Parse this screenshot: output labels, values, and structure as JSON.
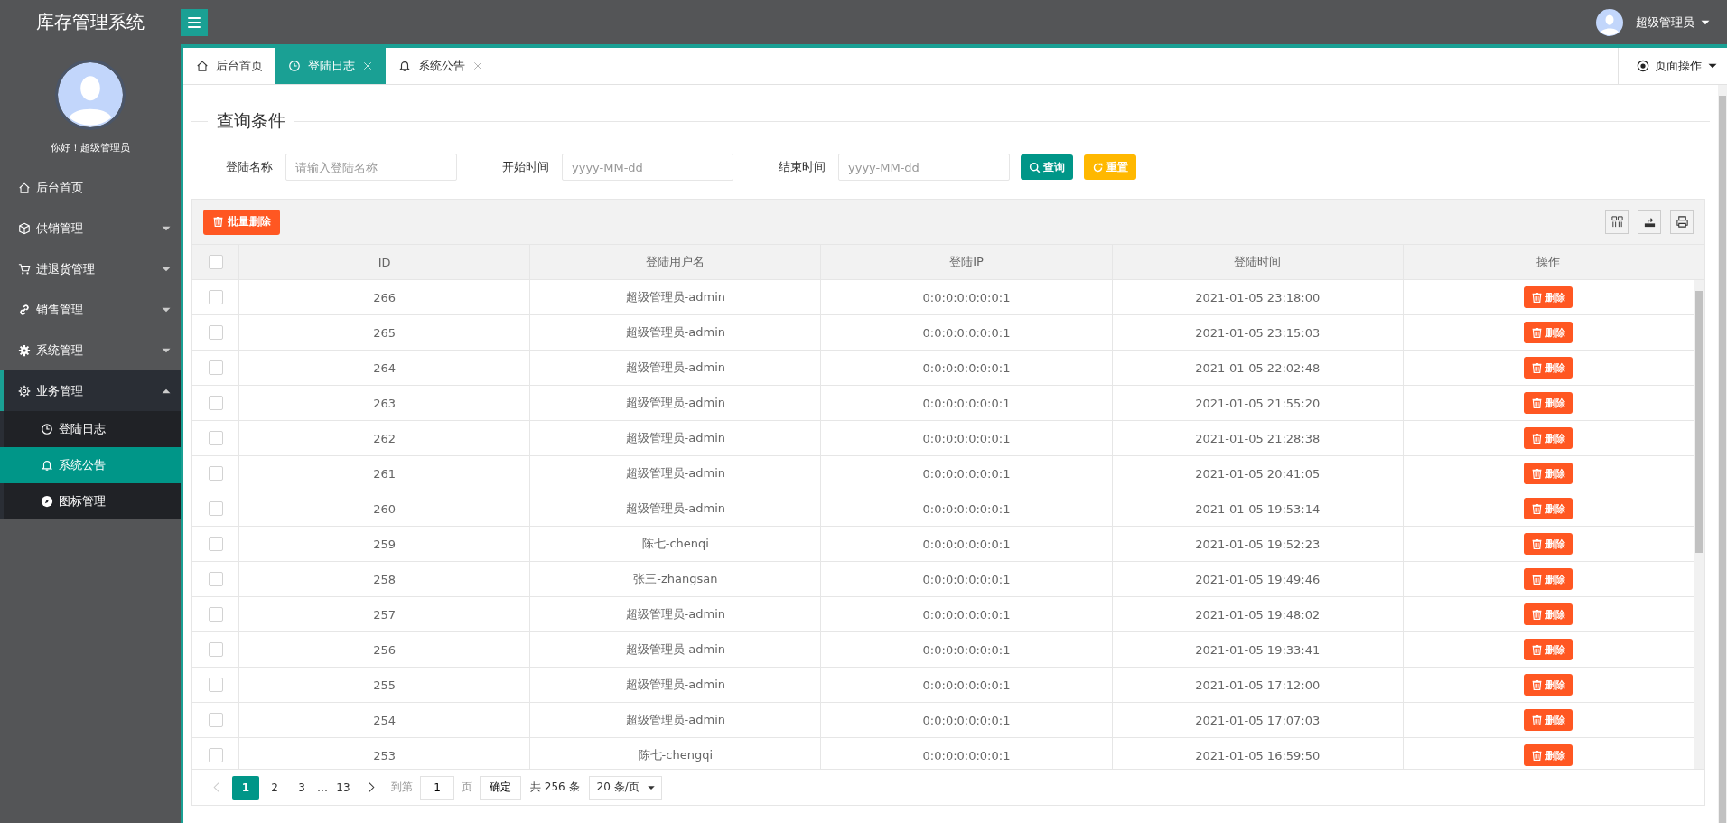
{
  "app_title": "库存管理系统",
  "user": {
    "name": "超级管理员"
  },
  "sidebar": {
    "greeting": "你好！超级管理员",
    "items": [
      {
        "label": "后台首页",
        "kind": "link",
        "selected": false
      },
      {
        "label": "供销管理",
        "kind": "group",
        "expanded": false,
        "selected": false
      },
      {
        "label": "进退货管理",
        "kind": "group",
        "expanded": false,
        "selected": false
      },
      {
        "label": "销售管理",
        "kind": "group",
        "expanded": false,
        "selected": false
      },
      {
        "label": "系统管理",
        "kind": "group",
        "expanded": false,
        "selected": false
      },
      {
        "label": "业务管理",
        "kind": "group",
        "expanded": true,
        "selected": false,
        "children": [
          {
            "label": "登陆日志",
            "selected": false
          },
          {
            "label": "系统公告",
            "selected": true
          },
          {
            "label": "图标管理",
            "selected": false
          }
        ]
      }
    ]
  },
  "tabs": [
    {
      "label": "后台首页",
      "selected": false,
      "closable": false
    },
    {
      "label": "登陆日志",
      "selected": true,
      "closable": true
    },
    {
      "label": "系统公告",
      "selected": false,
      "closable": true
    }
  ],
  "page_actions": "页面操作",
  "query": {
    "legend": "查询条件",
    "fields": [
      {
        "label": "登陆名称",
        "placeholder": "请输入登陆名称"
      },
      {
        "label": "开始时间",
        "placeholder": "yyyy-MM-dd"
      },
      {
        "label": "结束时间",
        "placeholder": "yyyy-MM-dd"
      }
    ],
    "buttons": [
      {
        "label": "查询",
        "kind": "search"
      },
      {
        "label": "重置",
        "kind": "reset"
      }
    ]
  },
  "table": {
    "batch_delete": "批量删除",
    "all_checked": false,
    "columns": [
      "ID",
      "登陆用户名",
      "登陆IP",
      "登陆时间",
      "操作"
    ],
    "rows": [
      {
        "checked": false,
        "id": "266",
        "user": "超级管理员-admin",
        "ip": "0:0:0:0:0:0:0:1",
        "time": "2021-01-05 23:18:00",
        "action": "删除"
      },
      {
        "checked": false,
        "id": "265",
        "user": "超级管理员-admin",
        "ip": "0:0:0:0:0:0:0:1",
        "time": "2021-01-05 23:15:03",
        "action": "删除"
      },
      {
        "checked": false,
        "id": "264",
        "user": "超级管理员-admin",
        "ip": "0:0:0:0:0:0:0:1",
        "time": "2021-01-05 22:02:48",
        "action": "删除"
      },
      {
        "checked": false,
        "id": "263",
        "user": "超级管理员-admin",
        "ip": "0:0:0:0:0:0:0:1",
        "time": "2021-01-05 21:55:20",
        "action": "删除"
      },
      {
        "checked": false,
        "id": "262",
        "user": "超级管理员-admin",
        "ip": "0:0:0:0:0:0:0:1",
        "time": "2021-01-05 21:28:38",
        "action": "删除"
      },
      {
        "checked": false,
        "id": "261",
        "user": "超级管理员-admin",
        "ip": "0:0:0:0:0:0:0:1",
        "time": "2021-01-05 20:41:05",
        "action": "删除"
      },
      {
        "checked": false,
        "id": "260",
        "user": "超级管理员-admin",
        "ip": "0:0:0:0:0:0:0:1",
        "time": "2021-01-05 19:53:14",
        "action": "删除"
      },
      {
        "checked": false,
        "id": "259",
        "user": "陈七-chenqi",
        "ip": "0:0:0:0:0:0:0:1",
        "time": "2021-01-05 19:52:23",
        "action": "删除"
      },
      {
        "checked": false,
        "id": "258",
        "user": "张三-zhangsan",
        "ip": "0:0:0:0:0:0:0:1",
        "time": "2021-01-05 19:49:46",
        "action": "删除"
      },
      {
        "checked": false,
        "id": "257",
        "user": "超级管理员-admin",
        "ip": "0:0:0:0:0:0:0:1",
        "time": "2021-01-05 19:48:02",
        "action": "删除"
      },
      {
        "checked": false,
        "id": "256",
        "user": "超级管理员-admin",
        "ip": "0:0:0:0:0:0:0:1",
        "time": "2021-01-05 19:33:41",
        "action": "删除"
      },
      {
        "checked": false,
        "id": "255",
        "user": "超级管理员-admin",
        "ip": "0:0:0:0:0:0:0:1",
        "time": "2021-01-05 17:12:00",
        "action": "删除"
      },
      {
        "checked": false,
        "id": "254",
        "user": "超级管理员-admin",
        "ip": "0:0:0:0:0:0:0:1",
        "time": "2021-01-05 17:07:03",
        "action": "删除"
      },
      {
        "checked": false,
        "id": "253",
        "user": "陈七-chengqi",
        "ip": "0:0:0:0:0:0:0:1",
        "time": "2021-01-05 16:59:50",
        "action": "删除"
      }
    ]
  },
  "pagination": {
    "pages": [
      {
        "label": "1",
        "selected": true
      },
      {
        "label": "2",
        "selected": false
      },
      {
        "label": "3",
        "selected": false
      },
      {
        "label": "…",
        "kind": "ellipsis"
      },
      {
        "label": "13",
        "selected": false
      }
    ],
    "goto_label": "到第",
    "goto_value": "1",
    "page_unit": "页",
    "confirm": "确定",
    "total": "共 256 条",
    "page_size": "20 条/页"
  }
}
